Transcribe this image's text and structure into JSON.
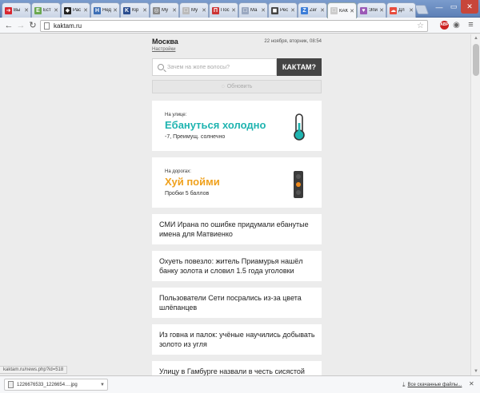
{
  "tabs": [
    {
      "title": "Вы",
      "color": "#d8262f",
      "glyph": "➜"
    },
    {
      "title": "Ест",
      "color": "#6aa84f",
      "glyph": "Е"
    },
    {
      "title": "Рас",
      "color": "#222222",
      "glyph": "◆"
    },
    {
      "title": "Нед",
      "color": "#3d6fb6",
      "glyph": "Н"
    },
    {
      "title": "Кір",
      "color": "#2a4d8f",
      "glyph": "K"
    },
    {
      "title": "Му",
      "color": "#888888",
      "glyph": "◎"
    },
    {
      "title": "Му",
      "color": "#bbbbbb",
      "glyph": "□"
    },
    {
      "title": "Пос",
      "color": "#cc3333",
      "glyph": "П"
    },
    {
      "title": "Ма",
      "color": "#9aa8c0",
      "glyph": "□"
    },
    {
      "title": "Рес",
      "color": "#444444",
      "glyph": "◼"
    },
    {
      "title": "Zer",
      "color": "#3b7dd8",
      "glyph": "Z"
    },
    {
      "title": "КАК",
      "color": "#cccccc",
      "glyph": "□",
      "active": true
    },
    {
      "title": "Эпи",
      "color": "#9b59b6",
      "glyph": "♥"
    },
    {
      "title": "Дл",
      "color": "#e84c3d",
      "glyph": "☁"
    }
  ],
  "address": {
    "url": "kaktam.ru"
  },
  "header": {
    "city": "Москва",
    "settings": "Настройки",
    "datetime": "22 ноября, вторник, 08:54"
  },
  "search": {
    "placeholder": "Зачем на жопе волосы?",
    "button": "КАКТАМ?"
  },
  "refresh": {
    "label": "Обновить"
  },
  "weather": {
    "label": "На улице:",
    "headline": "Ебануться холодно",
    "details": "-7, Преимущ. солнечно"
  },
  "traffic": {
    "label": "На дорогах:",
    "headline": "Хуй пойми",
    "details": "Пробки 5 баллов"
  },
  "news": [
    "СМИ Ирана по ошибке придумали ебанутые имена для Матвиенко",
    "Охуеть повезло: житель Приамурья нашёл банку золота и словил 1.5 года уголовки",
    "Пользователи Сети посрались из-за цвета шлёпанцев",
    "Из говна и палок: учёные научились добывать золото из угля",
    "Улицу в Гамбурге назвали в честь сисястой"
  ],
  "status": {
    "text": "kaktam.ru/news.php?id=518"
  },
  "downloads": {
    "file": "1226676533_12266​54….jpg",
    "all": "Все скачанные файлы..."
  },
  "colors": {
    "weather_accent": "#1fb4b0",
    "traffic_accent": "#f0a11c",
    "button_bg": "#444444"
  }
}
